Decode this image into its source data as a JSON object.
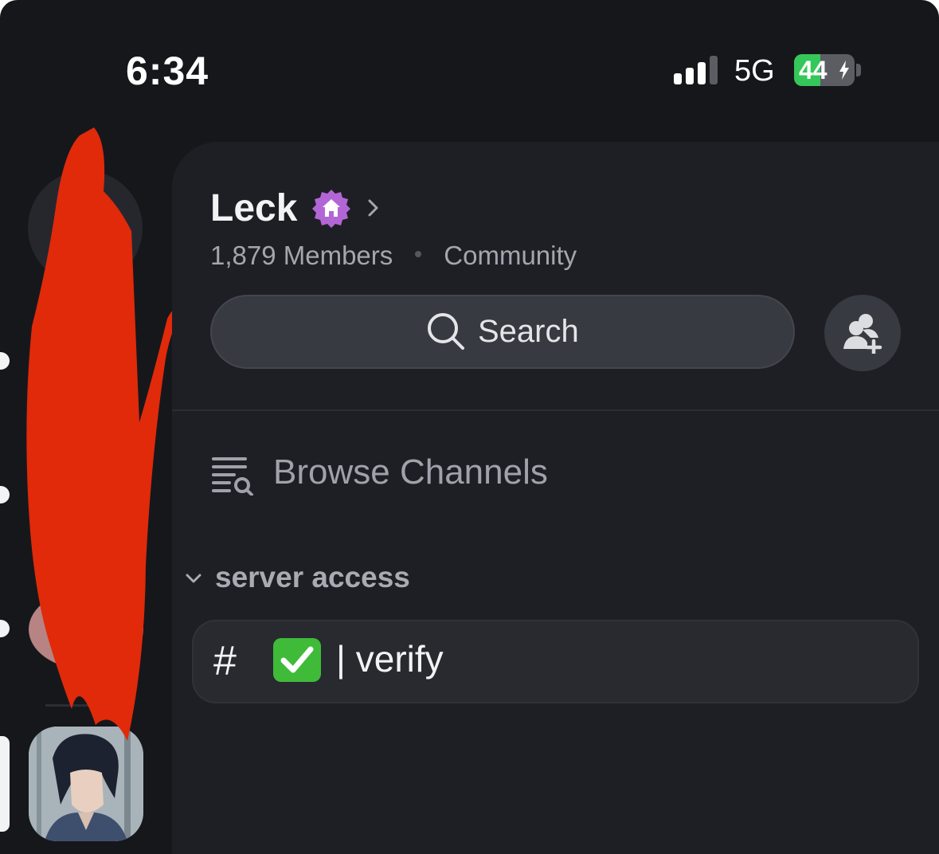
{
  "status_bar": {
    "time": "6:34",
    "network": "5G",
    "battery": "44",
    "battery_fraction": 0.44,
    "battery_color": "#35c759"
  },
  "server": {
    "name": "Leck",
    "members": "1,879 Members",
    "type": "Community",
    "badge_icon": "home-icon",
    "badge_color": "#b266d6"
  },
  "search": {
    "label": "Search"
  },
  "invite": {
    "icon": "add-member-icon"
  },
  "browse": {
    "label": "Browse Channels",
    "icon": "channel-browse-icon"
  },
  "category": {
    "label": "server access"
  },
  "channels": [
    {
      "prefix": "#",
      "emoji": "✅",
      "name": "| verify"
    }
  ],
  "rail": {
    "redaction_color": "#e02a0a"
  }
}
